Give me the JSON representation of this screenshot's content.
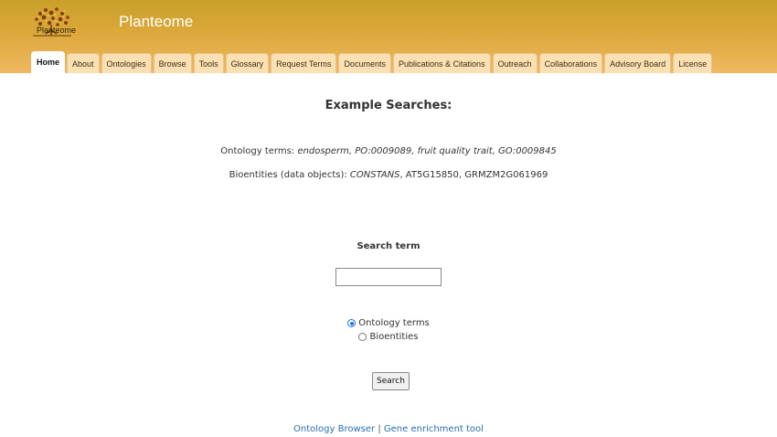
{
  "header": {
    "site_title": "Planteome",
    "logo_text": "Planteome",
    "tabs": [
      {
        "label": "Home",
        "active": true
      },
      {
        "label": "About"
      },
      {
        "label": "Ontologies"
      },
      {
        "label": "Browse"
      },
      {
        "label": "Tools"
      },
      {
        "label": "Glossary"
      },
      {
        "label": "Request Terms"
      },
      {
        "label": "Documents"
      },
      {
        "label": "Publications & Citations"
      },
      {
        "label": "Outreach"
      },
      {
        "label": "Collaborations"
      },
      {
        "label": "Advisory Board"
      },
      {
        "label": "License"
      }
    ]
  },
  "main": {
    "heading": "Example Searches:",
    "ontology_line": {
      "prefix": "Ontology terms: ",
      "examples": "endosperm, PO:0009089, fruit quality trait, GO:0009845"
    },
    "bioentity_line": {
      "prefix": "Bioentities (data objects): ",
      "example_italic": "CONSTANS",
      "examples_rest": ", AT5G15850, GRMZM2G061969"
    },
    "search_label": "Search term",
    "search_value": "",
    "radio_options": [
      {
        "label": "Ontology terms",
        "checked": true
      },
      {
        "label": "Bioentities",
        "checked": false
      }
    ],
    "search_button": "Search"
  },
  "footer": {
    "link1": "Ontology Browser",
    "separator": " | ",
    "link2": "Gene enrichment tool"
  },
  "colors": {
    "header_top": "#c9a02a",
    "header_bottom": "#f0b862",
    "tab_bg": "#fbe0b4",
    "link": "#2a6fb0"
  }
}
